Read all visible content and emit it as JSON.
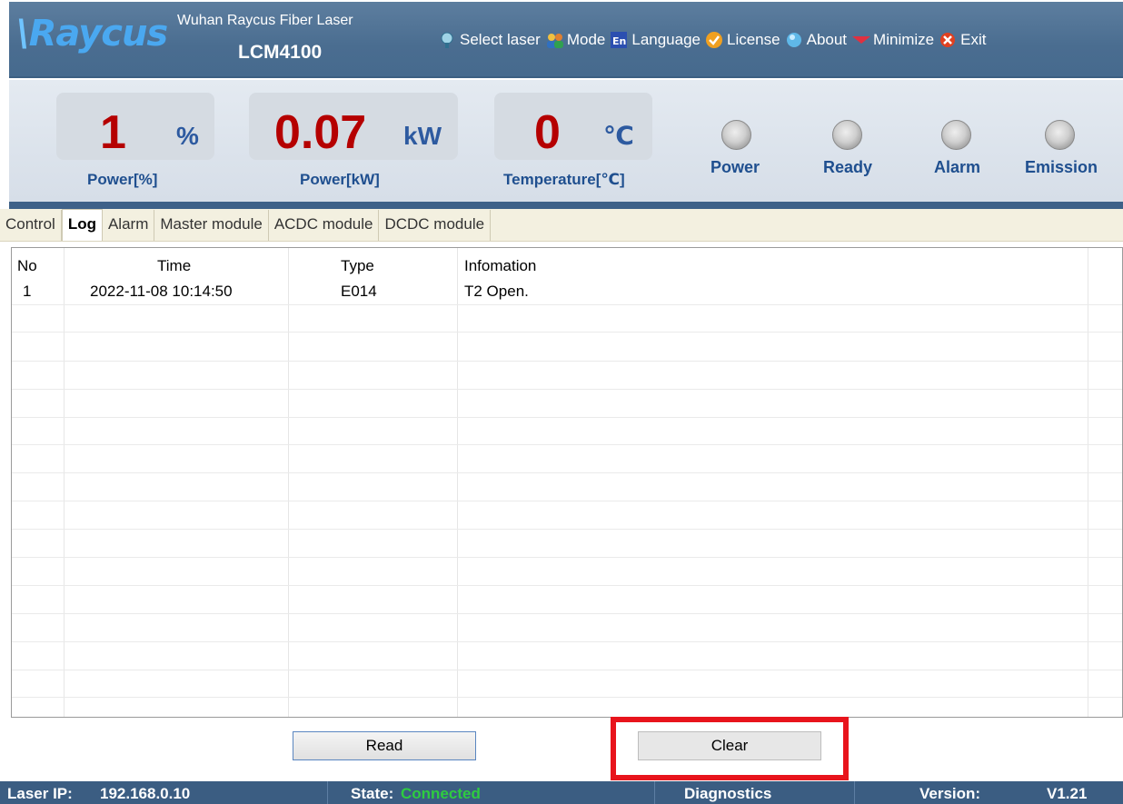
{
  "header": {
    "logo": "Raycus",
    "company": "Wuhan Raycus Fiber Laser",
    "model": "LCM4100",
    "menu": [
      {
        "label": "Select laser",
        "icon": "select-laser-icon"
      },
      {
        "label": "Mode",
        "icon": "mode-icon"
      },
      {
        "label": "Language",
        "icon": "language-icon"
      },
      {
        "label": "License",
        "icon": "license-icon"
      },
      {
        "label": "About",
        "icon": "about-icon"
      },
      {
        "label": "Minimize",
        "icon": "minimize-icon"
      },
      {
        "label": "Exit",
        "icon": "exit-icon"
      }
    ],
    "language_badge": "En"
  },
  "readouts": [
    {
      "value": "1",
      "unit": "%",
      "label": "Power[%]"
    },
    {
      "value": "0.07",
      "unit": "kW",
      "label": "Power[kW]"
    },
    {
      "value": "0",
      "unit": "℃",
      "label": "Temperature[℃]"
    }
  ],
  "indicators": [
    {
      "label": "Power",
      "state": "off"
    },
    {
      "label": "Ready",
      "state": "off"
    },
    {
      "label": "Alarm",
      "state": "off"
    },
    {
      "label": "Emission",
      "state": "off"
    }
  ],
  "tabs": [
    {
      "label": "Control",
      "active": false
    },
    {
      "label": "Log",
      "active": true
    },
    {
      "label": "Alarm",
      "active": false
    },
    {
      "label": "Master module",
      "active": false
    },
    {
      "label": "ACDC module",
      "active": false
    },
    {
      "label": "DCDC module",
      "active": false
    }
  ],
  "log": {
    "columns": [
      "No",
      "Time",
      "Type",
      "Infomation"
    ],
    "rows": [
      {
        "no": "1",
        "time": "2022-11-08 10:14:50",
        "type": "E014",
        "info": "T2 Open."
      }
    ]
  },
  "buttons": {
    "read": "Read",
    "clear": "Clear"
  },
  "status": {
    "ip_label": "Laser IP:",
    "ip": "192.168.0.10",
    "state_label": "State:",
    "state": "Connected",
    "diagnostics": "Diagnostics",
    "version_label": "Version:",
    "version": "V1.21"
  },
  "colors": {
    "header_blue": "#4a6d90",
    "value_red": "#b50000",
    "label_blue": "#1f4f8f",
    "connected_green": "#2ecc40",
    "highlight_red": "#e8141c"
  }
}
